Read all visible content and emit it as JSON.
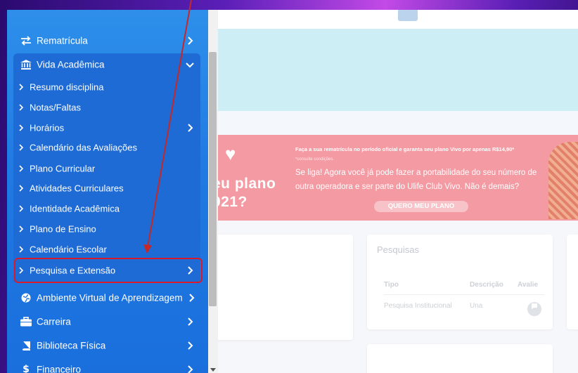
{
  "colors": {
    "sidebar": "#1f7ae3",
    "vida_panel": "#1e6bd6",
    "highlight": "#d81b2c",
    "arrow": "#c62828",
    "promo": "#f49aa3"
  },
  "sidebar": {
    "items_top": [
      {
        "label": "Rematrícula",
        "icon": "swap-arrows-icon"
      },
      {
        "label": "Vida Acadêmica",
        "icon": "institution-icon",
        "expanded": true
      }
    ],
    "submenu": [
      {
        "label": "Resumo disciplina"
      },
      {
        "label": "Notas/Faltas"
      },
      {
        "label": "Horários",
        "has_children": true
      },
      {
        "label": "Calendário das Avaliações"
      },
      {
        "label": "Plano Curricular"
      },
      {
        "label": "Atividades Curriculares"
      },
      {
        "label": "Identidade Acadêmica"
      },
      {
        "label": "Plano de Ensino"
      },
      {
        "label": "Calendário Escolar"
      },
      {
        "label": "Pesquisa e Extensão",
        "has_children": true,
        "highlighted": true
      }
    ],
    "items_bottom": [
      {
        "label": "Ambiente Virtual de Aprendizagem",
        "icon": "globe-icon"
      },
      {
        "label": "Carreira",
        "icon": "briefcase-icon"
      },
      {
        "label": "Biblioteca Física",
        "icon": "book-icon"
      },
      {
        "label": "Financeiro",
        "icon": "dollar-icon"
      }
    ]
  },
  "promo": {
    "big_line1": "eu plano",
    "big_line2": "021?",
    "line1": "Faça a sua rematrícula no período oficial e garanta seu plano Vivo por apenas R$14,90*",
    "line2": "*consulte condições.",
    "line3": "Se liga! Agora você já pode fazer a portabilidade do seu número de",
    "line4": "outra operadora e ser parte do Ulife Club Vivo. Não é demais?",
    "cta": "QUERO MEU PLANO"
  },
  "pesquisas": {
    "title": "Pesquisas",
    "columns": [
      "Tipo",
      "Descrição",
      "Avalie"
    ],
    "rows": [
      [
        "Pesquisa Institucional",
        "Una"
      ]
    ]
  }
}
